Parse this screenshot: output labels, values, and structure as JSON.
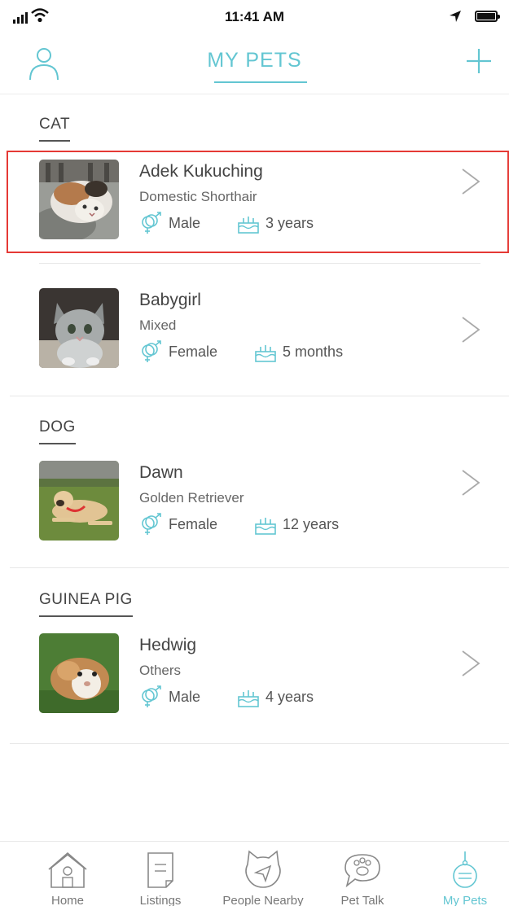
{
  "status_bar": {
    "time": "11:41 AM"
  },
  "header": {
    "title": "MY PETS"
  },
  "sections": [
    {
      "label": "CAT",
      "pets": [
        {
          "name": "Adek Kukuching",
          "breed": "Domestic Shorthair",
          "gender": "Male",
          "age": "3 years"
        },
        {
          "name": "Babygirl",
          "breed": "Mixed",
          "gender": "Female",
          "age": "5 months"
        }
      ]
    },
    {
      "label": "DOG",
      "pets": [
        {
          "name": "Dawn",
          "breed": "Golden Retriever",
          "gender": "Female",
          "age": "12 years"
        }
      ]
    },
    {
      "label": "GUINEA PIG",
      "pets": [
        {
          "name": "Hedwig",
          "breed": "Others",
          "gender": "Male",
          "age": "4 years"
        }
      ]
    }
  ],
  "tab_bar": {
    "tabs": [
      {
        "label": "Home",
        "icon": "home-icon"
      },
      {
        "label": "Listings",
        "icon": "listings-icon"
      },
      {
        "label": "People Nearby",
        "icon": "people-nearby-icon"
      },
      {
        "label": "Pet Talk",
        "icon": "pet-talk-icon"
      },
      {
        "label": "My Pets",
        "icon": "my-pets-icon",
        "active": true
      }
    ]
  },
  "colors": {
    "accent": "#63c6d2",
    "highlight": "#e53935"
  }
}
